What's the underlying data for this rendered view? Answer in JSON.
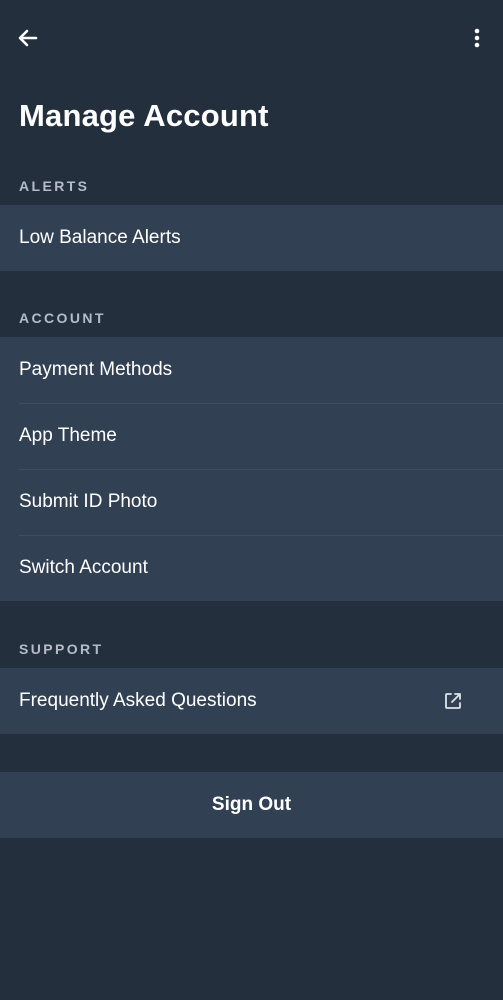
{
  "header": {
    "back_icon": "arrow-left-icon",
    "more_icon": "more-vertical-icon",
    "title": "Manage Account"
  },
  "sections": [
    {
      "header": "ALERTS",
      "items": [
        {
          "label": "Low Balance Alerts"
        }
      ]
    },
    {
      "header": "ACCOUNT",
      "items": [
        {
          "label": "Payment Methods"
        },
        {
          "label": "App Theme"
        },
        {
          "label": "Submit ID Photo"
        },
        {
          "label": "Switch Account"
        }
      ]
    },
    {
      "header": "SUPPORT",
      "items": [
        {
          "label": "Frequently Asked Questions",
          "trailing_icon": "external-link-icon"
        }
      ]
    }
  ],
  "sign_out": {
    "label": "Sign Out"
  },
  "colors": {
    "background": "#242f3e",
    "row_background": "#314053",
    "divider": "#3e4d61",
    "section_header_text": "#b4bcc8",
    "text": "#ffffff"
  }
}
